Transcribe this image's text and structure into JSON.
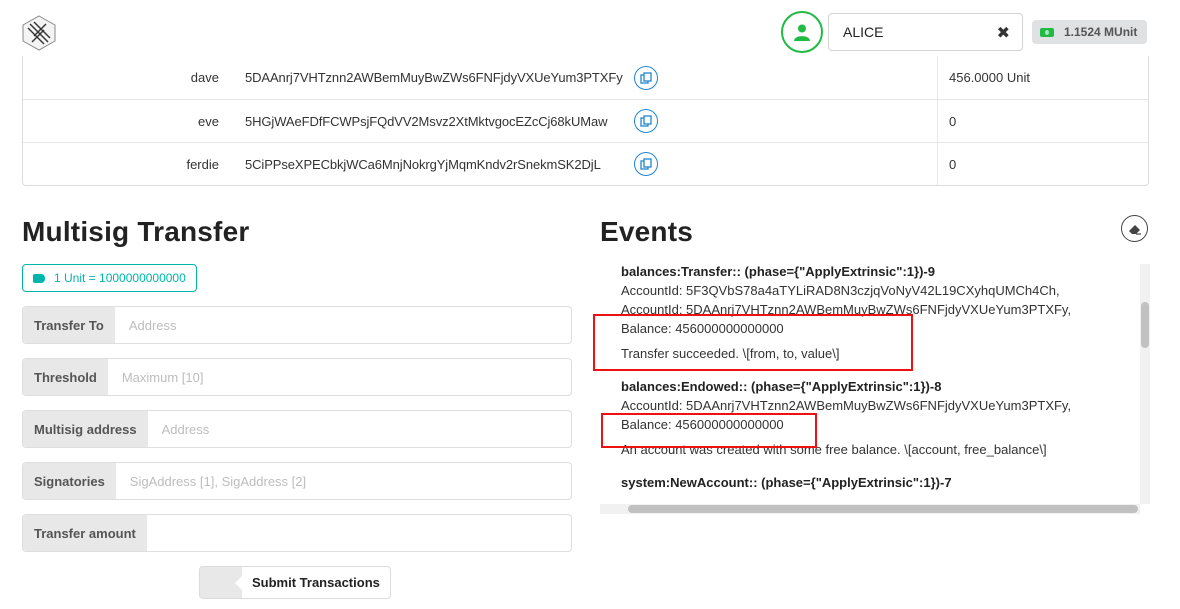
{
  "header": {
    "logo": "substrate-logo-icon",
    "account_name": "ALICE",
    "balance": "1.1524 MUnit"
  },
  "accounts": [
    {
      "name": "dave",
      "address": "5DAAnrj7VHTznn2AWBemMuyBwZWs6FNFjdyVXUeYum3PTXFy",
      "balance": "456.0000 Unit"
    },
    {
      "name": "eve",
      "address": "5HGjWAeFDfFCWPsjFQdVV2Msvz2XtMktvgocEZcCj68kUMaw",
      "balance": "0"
    },
    {
      "name": "ferdie",
      "address": "5CiPPseXPECbkjWCa6MnjNokrgYjMqmKndv2rSnekmSK2DjL",
      "balance": "0"
    }
  ],
  "multisig": {
    "title": "Multisig Transfer",
    "unit_info": "1 Unit = 1000000000000",
    "fields": [
      {
        "label": "Transfer To",
        "placeholder": "Address",
        "value": ""
      },
      {
        "label": "Threshold",
        "placeholder": "Maximum [10]",
        "value": ""
      },
      {
        "label": "Multisig address",
        "placeholder": "Address",
        "value": ""
      },
      {
        "label": "Signatories",
        "placeholder": "SigAddress [1], SigAddress [2]",
        "value": ""
      },
      {
        "label": "Transfer amount",
        "placeholder": "",
        "value": ""
      }
    ],
    "submit_label": "Submit Transactions"
  },
  "events": {
    "title": "Events",
    "items": [
      {
        "title": "balances:Transfer:: (phase={\"ApplyExtrinsic\":1})-9",
        "lines": [
          "AccountId: 5F3QVbS78a4aTYLiRAD8N3czjqVoNyV42L19CXyhqUMCh4Ch,",
          "AccountId: 5DAAnrj7VHTznn2AWBemMuyBwZWs6FNFjdyVXUeYum3PTXFy,",
          "Balance: 456000000000000"
        ],
        "description": "Transfer succeeded. \\[from, to, value\\]"
      },
      {
        "title": "balances:Endowed:: (phase={\"ApplyExtrinsic\":1})-8",
        "lines": [
          "AccountId: 5DAAnrj7VHTznn2AWBemMuyBwZWs6FNFjdyVXUeYum3PTXFy,",
          "Balance: 456000000000000"
        ],
        "description": "An account was created with some free balance. \\[account, free_balance\\]"
      },
      {
        "title": "system:NewAccount:: (phase={\"ApplyExtrinsic\":1})-7",
        "lines": [],
        "description": ""
      }
    ]
  },
  "colors": {
    "green": "#21ba45",
    "teal": "#00b5ad",
    "blue": "#2185d0",
    "highlight_red": "#ee1111"
  }
}
